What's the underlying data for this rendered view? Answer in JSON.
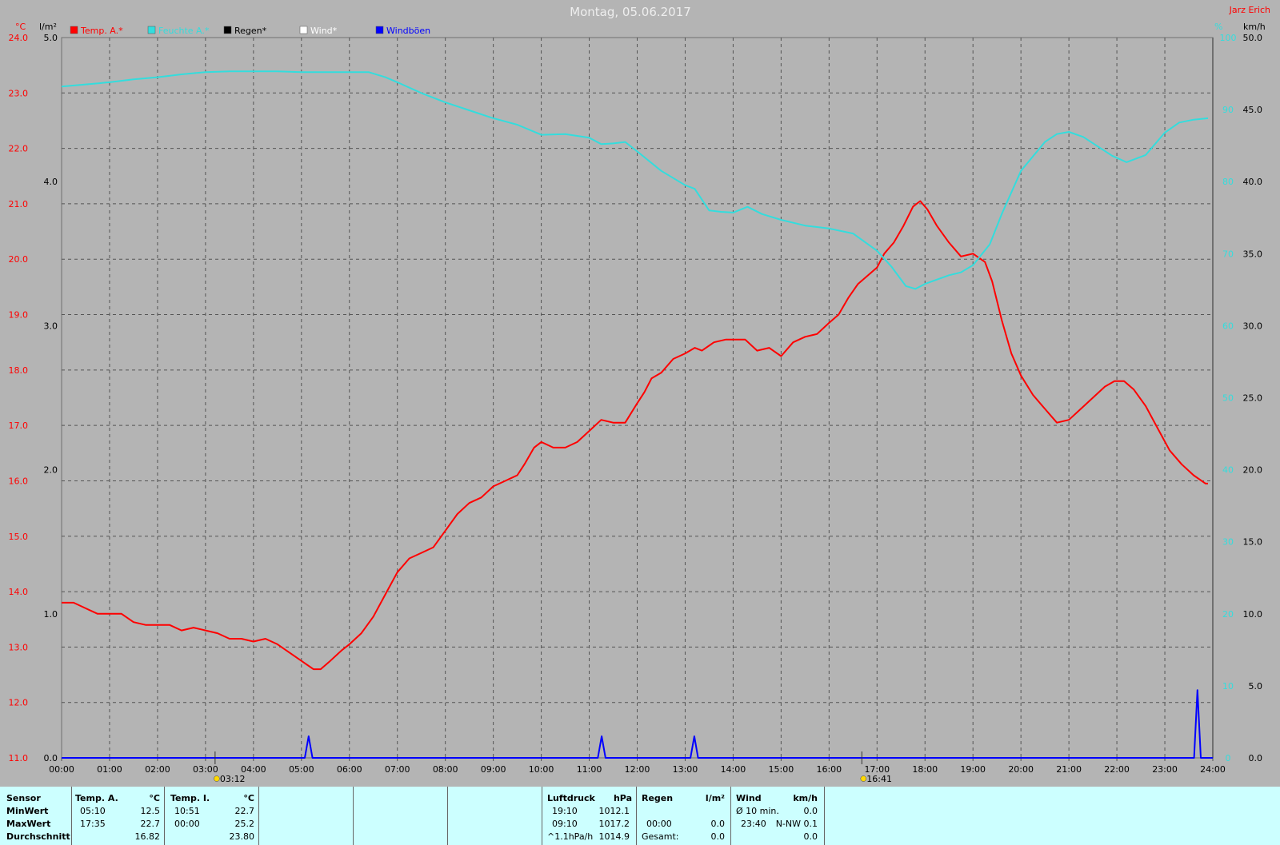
{
  "title": "Montag, 05.06.2017",
  "author": "Jarz Erich",
  "units": {
    "temp": "°C",
    "rain": "l/m²",
    "hum": "%",
    "wind": "km/h"
  },
  "legend": [
    {
      "label": "Temp. A.*",
      "color": "#ff0000"
    },
    {
      "label": "Feuchte A.*",
      "color": "#33dddd"
    },
    {
      "label": "Regen*",
      "color": "#000000"
    },
    {
      "label": "Wind*",
      "color": "#ffffff"
    },
    {
      "label": "Windböen",
      "color": "#0000ff"
    }
  ],
  "sun": {
    "rise": "03:12",
    "set": "16:41"
  },
  "chart_data": {
    "type": "line",
    "x_ticks": [
      "00:00",
      "01:00",
      "02:00",
      "03:00",
      "04:00",
      "05:00",
      "06:00",
      "07:00",
      "08:00",
      "09:00",
      "10:00",
      "11:00",
      "12:00",
      "13:00",
      "14:00",
      "15:00",
      "16:00",
      "17:00",
      "18:00",
      "19:00",
      "20:00",
      "21:00",
      "22:00",
      "23:00",
      "24:00"
    ],
    "axes": {
      "temp": {
        "min": 11,
        "max": 24,
        "ticks": [
          "11.0",
          "12.0",
          "13.0",
          "14.0",
          "15.0",
          "16.0",
          "17.0",
          "18.0",
          "19.0",
          "20.0",
          "21.0",
          "22.0",
          "23.0",
          "24.0"
        ]
      },
      "rain": {
        "min": 0,
        "max": 5,
        "ticks": [
          "0.0",
          "1.0",
          "2.0",
          "3.0",
          "4.0",
          "5.0"
        ]
      },
      "hum": {
        "min": 0,
        "max": 100,
        "ticks": [
          "0",
          "10",
          "20",
          "30",
          "40",
          "50",
          "60",
          "70",
          "80",
          "90",
          "100"
        ]
      },
      "wind": {
        "min": 0,
        "max": 50,
        "ticks": [
          "0.0",
          "5.0",
          "10.0",
          "15.0",
          "20.0",
          "25.0",
          "30.0",
          "35.0",
          "40.0",
          "45.0",
          "50.0"
        ]
      }
    },
    "series": [
      {
        "name": "Temp. A.*",
        "axis": "temp",
        "color": "#ff0000",
        "points": [
          [
            0,
            13.8
          ],
          [
            0.25,
            13.8
          ],
          [
            0.5,
            13.7
          ],
          [
            0.75,
            13.6
          ],
          [
            1.25,
            13.6
          ],
          [
            1.5,
            13.45
          ],
          [
            1.75,
            13.4
          ],
          [
            2.25,
            13.4
          ],
          [
            2.5,
            13.3
          ],
          [
            2.75,
            13.35
          ],
          [
            3.0,
            13.3
          ],
          [
            3.25,
            13.25
          ],
          [
            3.5,
            13.15
          ],
          [
            3.75,
            13.15
          ],
          [
            4.0,
            13.1
          ],
          [
            4.25,
            13.15
          ],
          [
            4.5,
            13.05
          ],
          [
            4.75,
            12.9
          ],
          [
            5.0,
            12.75
          ],
          [
            5.25,
            12.6
          ],
          [
            5.4,
            12.6
          ],
          [
            5.6,
            12.75
          ],
          [
            5.85,
            12.95
          ],
          [
            6.0,
            13.05
          ],
          [
            6.25,
            13.25
          ],
          [
            6.5,
            13.55
          ],
          [
            6.75,
            13.95
          ],
          [
            7.0,
            14.35
          ],
          [
            7.25,
            14.6
          ],
          [
            7.5,
            14.7
          ],
          [
            7.75,
            14.8
          ],
          [
            8.0,
            15.1
          ],
          [
            8.25,
            15.4
          ],
          [
            8.5,
            15.6
          ],
          [
            8.75,
            15.7
          ],
          [
            9.0,
            15.9
          ],
          [
            9.25,
            16.0
          ],
          [
            9.5,
            16.1
          ],
          [
            9.65,
            16.3
          ],
          [
            9.85,
            16.6
          ],
          [
            10.0,
            16.7
          ],
          [
            10.25,
            16.6
          ],
          [
            10.5,
            16.6
          ],
          [
            10.75,
            16.7
          ],
          [
            11.0,
            16.9
          ],
          [
            11.25,
            17.1
          ],
          [
            11.5,
            17.05
          ],
          [
            11.75,
            17.05
          ],
          [
            12.0,
            17.4
          ],
          [
            12.15,
            17.6
          ],
          [
            12.3,
            17.85
          ],
          [
            12.5,
            17.95
          ],
          [
            12.75,
            18.2
          ],
          [
            13.0,
            18.3
          ],
          [
            13.2,
            18.4
          ],
          [
            13.35,
            18.35
          ],
          [
            13.6,
            18.5
          ],
          [
            13.85,
            18.55
          ],
          [
            14.1,
            18.55
          ],
          [
            14.25,
            18.55
          ],
          [
            14.5,
            18.35
          ],
          [
            14.75,
            18.4
          ],
          [
            15.0,
            18.25
          ],
          [
            15.25,
            18.5
          ],
          [
            15.5,
            18.6
          ],
          [
            15.75,
            18.65
          ],
          [
            16.0,
            18.85
          ],
          [
            16.2,
            19.0
          ],
          [
            16.4,
            19.3
          ],
          [
            16.6,
            19.55
          ],
          [
            16.8,
            19.7
          ],
          [
            17.0,
            19.85
          ],
          [
            17.15,
            20.1
          ],
          [
            17.35,
            20.3
          ],
          [
            17.55,
            20.6
          ],
          [
            17.75,
            20.95
          ],
          [
            17.9,
            21.05
          ],
          [
            18.05,
            20.9
          ],
          [
            18.25,
            20.6
          ],
          [
            18.5,
            20.3
          ],
          [
            18.75,
            20.05
          ],
          [
            19.0,
            20.1
          ],
          [
            19.25,
            19.95
          ],
          [
            19.4,
            19.6
          ],
          [
            19.6,
            18.9
          ],
          [
            19.8,
            18.3
          ],
          [
            20.0,
            17.9
          ],
          [
            20.25,
            17.55
          ],
          [
            20.5,
            17.3
          ],
          [
            20.75,
            17.05
          ],
          [
            21.0,
            17.1
          ],
          [
            21.25,
            17.3
          ],
          [
            21.5,
            17.5
          ],
          [
            21.75,
            17.7
          ],
          [
            21.95,
            17.8
          ],
          [
            22.15,
            17.8
          ],
          [
            22.35,
            17.65
          ],
          [
            22.6,
            17.35
          ],
          [
            22.85,
            16.95
          ],
          [
            23.1,
            16.55
          ],
          [
            23.35,
            16.3
          ],
          [
            23.6,
            16.1
          ],
          [
            23.85,
            15.95
          ],
          [
            23.9,
            15.95
          ]
        ]
      },
      {
        "name": "Feuchte A.*",
        "axis": "hum",
        "color": "#33dddd",
        "points": [
          [
            0,
            93.2
          ],
          [
            0.5,
            93.5
          ],
          [
            1.0,
            93.8
          ],
          [
            1.5,
            94.2
          ],
          [
            2.0,
            94.5
          ],
          [
            2.5,
            94.9
          ],
          [
            3.0,
            95.2
          ],
          [
            3.5,
            95.3
          ],
          [
            4.0,
            95.3
          ],
          [
            4.5,
            95.3
          ],
          [
            5.0,
            95.2
          ],
          [
            5.5,
            95.2
          ],
          [
            6.0,
            95.2
          ],
          [
            6.4,
            95.2
          ],
          [
            6.75,
            94.5
          ],
          [
            7.0,
            93.8
          ],
          [
            7.5,
            92.3
          ],
          [
            8.0,
            91.0
          ],
          [
            8.5,
            89.9
          ],
          [
            9.0,
            88.8
          ],
          [
            9.5,
            87.9
          ],
          [
            10.0,
            86.5
          ],
          [
            10.5,
            86.6
          ],
          [
            11.0,
            86.1
          ],
          [
            11.25,
            85.2
          ],
          [
            11.5,
            85.3
          ],
          [
            11.75,
            85.5
          ],
          [
            12.0,
            84.2
          ],
          [
            12.5,
            81.5
          ],
          [
            13.0,
            79.5
          ],
          [
            13.2,
            79.0
          ],
          [
            13.5,
            76.0
          ],
          [
            13.75,
            75.8
          ],
          [
            14.0,
            75.7
          ],
          [
            14.3,
            76.5
          ],
          [
            14.6,
            75.5
          ],
          [
            15.0,
            74.7
          ],
          [
            15.5,
            73.9
          ],
          [
            16.0,
            73.5
          ],
          [
            16.5,
            72.8
          ],
          [
            17.0,
            70.4
          ],
          [
            17.3,
            68.2
          ],
          [
            17.6,
            65.5
          ],
          [
            17.8,
            65.1
          ],
          [
            18.0,
            65.8
          ],
          [
            18.5,
            67.0
          ],
          [
            18.75,
            67.4
          ],
          [
            19.0,
            68.4
          ],
          [
            19.35,
            71.3
          ],
          [
            19.6,
            75.5
          ],
          [
            20.0,
            81.5
          ],
          [
            20.5,
            85.5
          ],
          [
            20.75,
            86.6
          ],
          [
            21.0,
            86.9
          ],
          [
            21.3,
            86.2
          ],
          [
            21.6,
            84.9
          ],
          [
            21.9,
            83.6
          ],
          [
            22.2,
            82.7
          ],
          [
            22.6,
            83.7
          ],
          [
            23.0,
            86.8
          ],
          [
            23.3,
            88.2
          ],
          [
            23.6,
            88.6
          ],
          [
            23.9,
            88.8
          ]
        ]
      },
      {
        "name": "Windböen",
        "axis": "wind",
        "color": "#0000ff",
        "points": [
          [
            0,
            0
          ],
          [
            5.07,
            0
          ],
          [
            5.15,
            1.5
          ],
          [
            5.23,
            0
          ],
          [
            11.18,
            0
          ],
          [
            11.26,
            1.5
          ],
          [
            11.34,
            0
          ],
          [
            13.11,
            0
          ],
          [
            13.19,
            1.5
          ],
          [
            13.27,
            0
          ],
          [
            23.61,
            0
          ],
          [
            23.68,
            4.7
          ],
          [
            23.75,
            0
          ],
          [
            24,
            0
          ]
        ]
      }
    ]
  },
  "table": [
    {
      "header": [
        "Sensor"
      ],
      "rows": [
        [
          "MinWert"
        ],
        [
          "MaxWert"
        ],
        [
          "Durchschnitt"
        ]
      ]
    },
    {
      "header": [
        "Temp. A.",
        "°C"
      ],
      "rows": [
        [
          "05:10",
          "12.5"
        ],
        [
          "17:35",
          "22.7"
        ],
        [
          "",
          "16.82"
        ]
      ]
    },
    {
      "header": [
        "Temp. I.",
        "°C"
      ],
      "rows": [
        [
          "10:51",
          "22.7"
        ],
        [
          "00:00",
          "25.2"
        ],
        [
          "",
          "23.80"
        ]
      ]
    },
    {
      "header": [
        "Luftdruck",
        "hPa"
      ],
      "rows": [
        [
          "19:10",
          "1012.1"
        ],
        [
          "09:10",
          "1017.2"
        ],
        [
          "^1.1hPa/h",
          "1014.9"
        ]
      ]
    },
    {
      "header": [
        "Regen",
        "l/m²"
      ],
      "rows": [
        [
          "",
          ""
        ],
        [
          "00:00",
          "0.0"
        ],
        [
          "Gesamt:",
          "0.0"
        ]
      ]
    },
    {
      "header": [
        "Wind",
        "km/h"
      ],
      "rows": [
        [
          "Ø 10 min.",
          "0.0"
        ],
        [
          "23:40",
          "N-NW 0.1"
        ],
        [
          "",
          "0.0"
        ]
      ]
    }
  ]
}
